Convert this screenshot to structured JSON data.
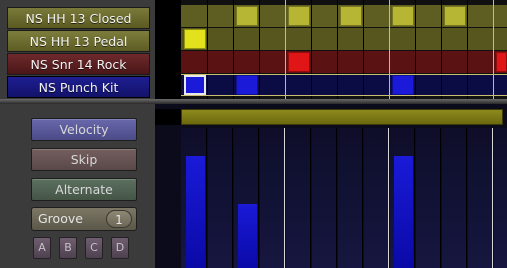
{
  "tracks": [
    {
      "name": "NS HH 13 Closed",
      "color": "#69692a"
    },
    {
      "name": "NS HH 13 Pedal",
      "color": "#6d6d2c"
    },
    {
      "name": "NS Snr 14 Rock",
      "color": "#5c1f20"
    },
    {
      "name": "NS Punch Kit",
      "color": "#16167a"
    }
  ],
  "controls": {
    "velocity": "Velocity",
    "skip": "Skip",
    "alternate": "Alternate",
    "groove_label": "Groove",
    "groove_value": "1",
    "patterns": [
      "A",
      "B",
      "C",
      "D"
    ]
  },
  "colors": {
    "velocity_btn": "#5a5a9a",
    "skip_btn": "#6a5a5a",
    "alternate_btn": "#556a55",
    "hh_closed_on": "#b6b634",
    "hh_pedal_on": "#e2e21c",
    "snare_on": "#e01515",
    "kick_on": "#1a1ad8",
    "velocity_bar": "#1a1ad8"
  }
}
